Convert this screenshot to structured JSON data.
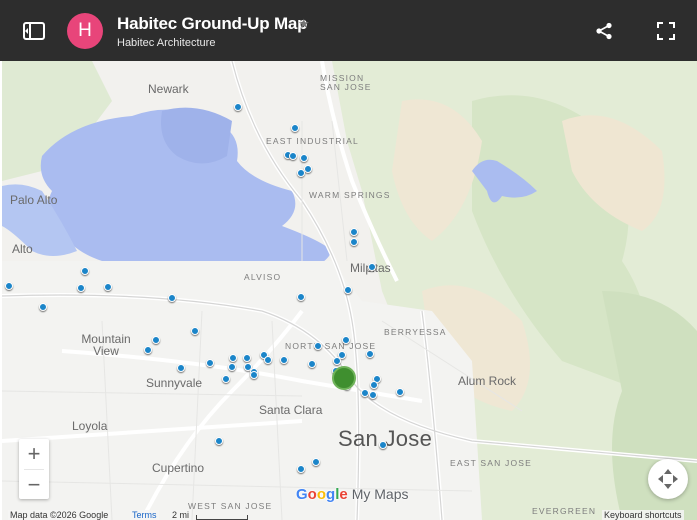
{
  "header": {
    "avatar_letter": "H",
    "avatar_color": "#e8457a",
    "title": "Habitec Ground-Up Map",
    "subtitle": "Habitec Architecture",
    "icons": [
      "sidebar-toggle-icon",
      "star-icon",
      "share-icon",
      "fullscreen-icon"
    ]
  },
  "map": {
    "places": {
      "newark": "Newark",
      "mission_san_jose_1": "MISSION",
      "mission_san_jose_2": "SAN JOSE",
      "east_industrial": "EAST INDUSTRIAL",
      "warm_springs": "WARM SPRINGS",
      "palo_alto": "Palo Alto",
      "alto": "Alto",
      "alviso": "ALVISO",
      "milpitas": "Milpitas",
      "berryessa": "BERRYESSA",
      "mountain_view_1": "Mountain",
      "mountain_view_2": "View",
      "north_san_jose": "NORTH SAN JOSE",
      "sunnyvale": "Sunnyvale",
      "alum_rock": "Alum Rock",
      "santa_clara": "Santa Clara",
      "loyola": "Loyola",
      "san_jose": "San Jose",
      "east_san_jose": "EAST SAN JOSE",
      "cupertino": "Cupertino",
      "west_san_jose": "WEST SAN JOSE",
      "evergreen": "EVERGREEN"
    },
    "marker_color": "#1b85c9",
    "cluster_color": "#3f8f2f",
    "water_color": "#aabcf0"
  },
  "controls": {
    "zoom_in": "+",
    "zoom_out": "−"
  },
  "logo": {
    "google": "Google",
    "my_maps": "My Maps"
  },
  "footer": {
    "map_data": "Map data ©2026 Google",
    "terms": "Terms",
    "scale": "2 mi",
    "shortcuts": "Keyboard shortcuts"
  }
}
